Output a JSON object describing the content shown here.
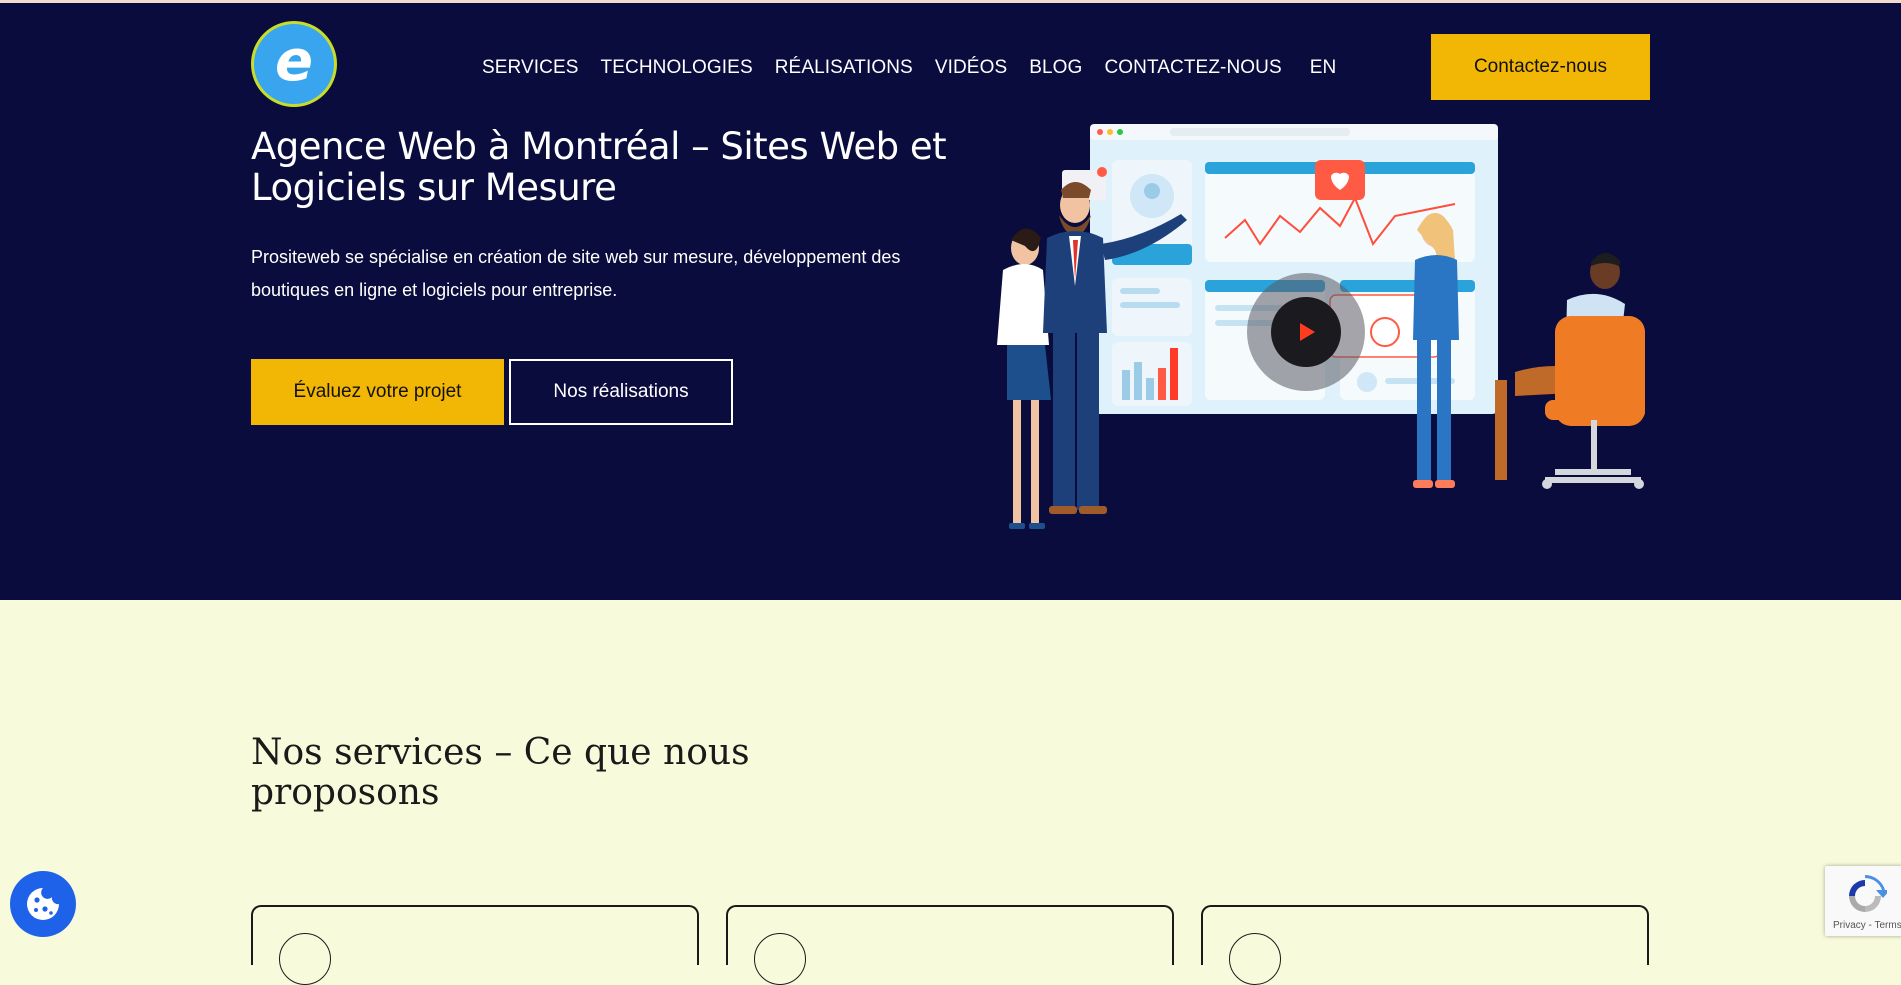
{
  "header": {
    "logo_letter": "e",
    "nav": [
      "SERVICES",
      "TECHNOLOGIES",
      "RÉALISATIONS",
      "VIDÉOS",
      "BLOG",
      "CONTACTEZ-NOUS",
      "EN"
    ],
    "cta_label": "Contactez-nous"
  },
  "hero": {
    "title": "Agence Web à Montréal – Sites Web et Logiciels sur Mesure",
    "description": "Prositeweb se spécialise en création de site web sur mesure, développement des boutiques en ligne et logiciels pour entreprise.",
    "primary_button": "Évaluez votre projet",
    "secondary_button": "Nos réalisations"
  },
  "services": {
    "title": "Nos services – Ce que nous proposons",
    "card_count": 3
  },
  "recaptcha": {
    "text": "Privacy - Terms"
  },
  "colors": {
    "hero_background": "#0a0c3d",
    "accent": "#f2b705",
    "page_background": "#f8fbdb",
    "cookie_button": "#1f62ea",
    "logo": "#3aa5ef"
  },
  "icons": [
    "logo-icon",
    "play-icon",
    "cookie-icon",
    "recaptcha-icon"
  ]
}
